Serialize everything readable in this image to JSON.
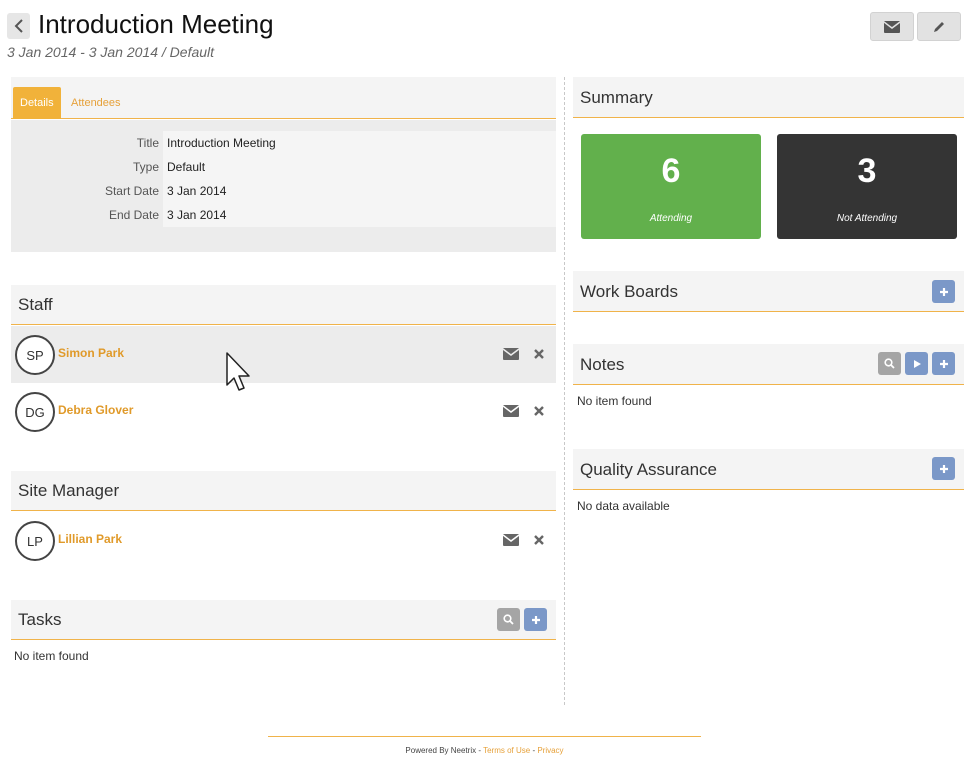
{
  "header": {
    "title": "Introduction Meeting",
    "subtitle": "3 Jan 2014 - 3 Jan 2014 / Default"
  },
  "tabs": [
    {
      "label": "Details",
      "active": true
    },
    {
      "label": "Attendees",
      "active": false
    }
  ],
  "details": [
    {
      "label": "Title",
      "value": "Introduction Meeting"
    },
    {
      "label": "Type",
      "value": "Default"
    },
    {
      "label": "Start Date",
      "value": "3 Jan 2014"
    },
    {
      "label": "End Date",
      "value": "3 Jan 2014"
    }
  ],
  "staff": {
    "title": "Staff",
    "people": [
      {
        "initials": "SP",
        "name": "Simon Park"
      },
      {
        "initials": "DG",
        "name": "Debra Glover"
      }
    ]
  },
  "site_manager": {
    "title": "Site Manager",
    "people": [
      {
        "initials": "LP",
        "name": "Lillian Park"
      }
    ]
  },
  "tasks": {
    "title": "Tasks",
    "empty": "No item found"
  },
  "summary": {
    "title": "Summary",
    "attending": {
      "count": "6",
      "label": "Attending"
    },
    "not_attending": {
      "count": "3",
      "label": "Not Attending"
    }
  },
  "work_boards": {
    "title": "Work Boards"
  },
  "notes": {
    "title": "Notes",
    "empty": "No item found"
  },
  "quality_assurance": {
    "title": "Quality Assurance",
    "empty": "No data available"
  },
  "footer": {
    "powered": "Powered By Neetrix",
    "sep1": " - ",
    "terms": "Terms of Use",
    "sep2": " - ",
    "privacy": "Privacy"
  },
  "colors": {
    "accent": "#f1b23a",
    "attending": "#62b04c",
    "not_attending": "#343434",
    "action_blue": "#7b98c8",
    "action_grey": "#a5a5a5",
    "person_link": "#e09a2a"
  }
}
